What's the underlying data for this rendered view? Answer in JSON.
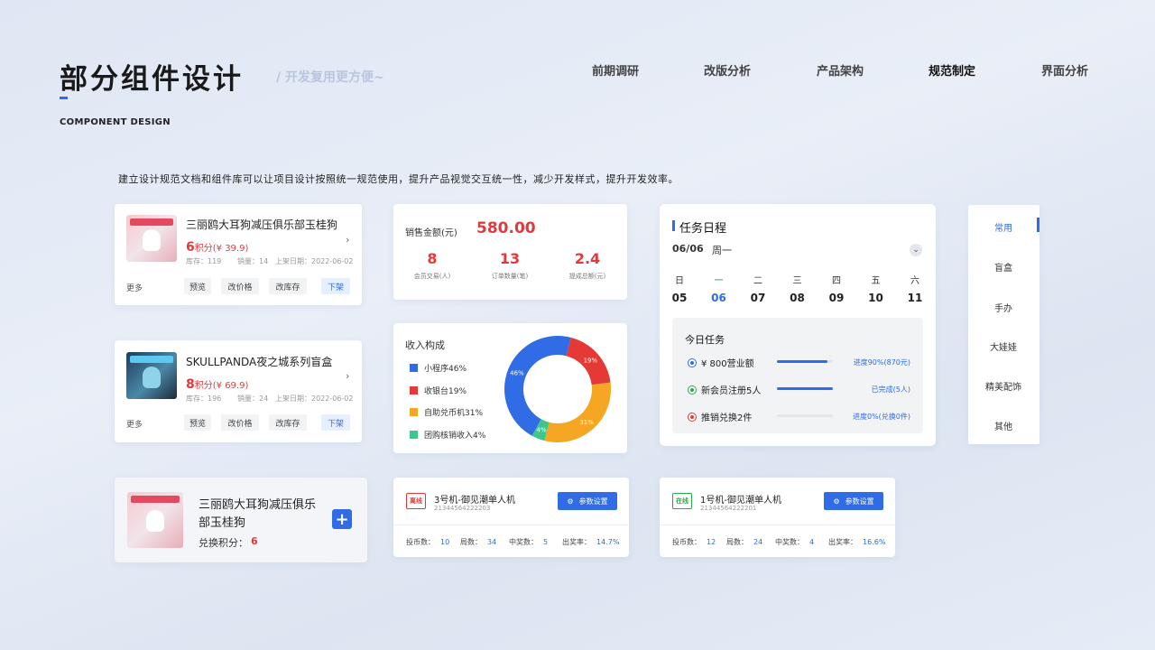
{
  "header": {
    "title": "部分组件设计",
    "subtitle": "/ 开发复用更方便~",
    "en_title": "COMPONENT DESIGN",
    "nav": [
      "前期调研",
      "改版分析",
      "产品架构",
      "规范制定",
      "界面分析"
    ],
    "active_nav": "规范制定"
  },
  "intro": "建立设计规范文档和组件库可以让项目设计按照统一规范使用，提升产品视觉交互统一性，减少开发样式，提升开发效率。",
  "products": [
    {
      "name": "三丽鸥大耳狗减压俱乐部玉桂狗",
      "points": "6",
      "price_text": "积分(¥ 39.9)",
      "stock": "库存：119",
      "sales": "销量：14",
      "date": "上架日期：2022-06-02",
      "more": "更多",
      "buttons": [
        "预览",
        "改价格",
        "改库存",
        "下架"
      ]
    },
    {
      "name": "SKULLPANDA夜之城系列盲盒",
      "points": "8",
      "price_text": "积分(¥ 69.9)",
      "stock": "库存：196",
      "sales": "销量：24",
      "date": "上架日期：2022-06-02",
      "more": "更多",
      "buttons": [
        "预览",
        "改价格",
        "改库存",
        "下架"
      ]
    }
  ],
  "redeem": {
    "name_line1": "三丽鸥大耳狗减压俱乐",
    "name_line2": "部玉桂狗",
    "label": "兑换积分：",
    "points": "6",
    "add_icon": "plus-icon"
  },
  "sales": {
    "label": "销售金额(元)",
    "amount": "580.00",
    "kpis": [
      {
        "value": "8",
        "label": "会员交易(人)"
      },
      {
        "value": "13",
        "label": "订单数量(笔)"
      },
      {
        "value": "2.4",
        "label": "提成总额(元)"
      }
    ]
  },
  "income": {
    "title": "收入构成",
    "legend": [
      {
        "label": "小程序46%",
        "color": "#2f6ce5"
      },
      {
        "label": "收银台19%",
        "color": "#e53935"
      },
      {
        "label": "自助兑币机31%",
        "color": "#f5a623"
      },
      {
        "label": "团购核销收入4%",
        "color": "#3cc88a"
      }
    ],
    "chart_data": {
      "type": "pie",
      "categories": [
        "小程序",
        "收银台",
        "自助兑币机",
        "团购核销收入"
      ],
      "values": [
        46,
        19,
        31,
        4
      ],
      "data_labels": [
        "46%",
        "19%",
        "31%",
        "4%"
      ],
      "colors": [
        "#2f6ce5",
        "#e53935",
        "#f5a623",
        "#3cc88a"
      ]
    }
  },
  "schedule": {
    "title": "任务日程",
    "date": "06/06",
    "weekday": "周一",
    "week_heads": [
      "日",
      "一",
      "二",
      "三",
      "四",
      "五",
      "六"
    ],
    "days": [
      "05",
      "06",
      "07",
      "08",
      "09",
      "10",
      "11"
    ],
    "selected_index": 1,
    "today_title": "今日任务",
    "tasks": [
      {
        "label": "¥ 800营业额",
        "note": "进度90%(870元)",
        "progress": 0.9,
        "color": "#2f6ce5"
      },
      {
        "label": "新会员注册5人",
        "note": "已完成(5人)",
        "progress": 1.0,
        "color": "#2aa84a"
      },
      {
        "label": "推销兑换2件",
        "note": "进度0%(兑换0件)",
        "progress": 0.0,
        "color": "#e53935"
      }
    ]
  },
  "side_menu": {
    "items": [
      "常用",
      "盲盒",
      "手办",
      "大娃娃",
      "精美配饰",
      "其他"
    ],
    "active": "常用"
  },
  "machines": [
    {
      "status": "离线",
      "status_color": "#e53935",
      "name": "3号机-御见潮单人机",
      "id": "21344564222203",
      "button": "参数设置",
      "stats": [
        {
          "k": "投币数：",
          "v": "10"
        },
        {
          "k": "局数：",
          "v": "34"
        },
        {
          "k": "中奖数：",
          "v": "5"
        },
        {
          "k": "出奖率：",
          "v": "14.7%"
        }
      ]
    },
    {
      "status": "在线",
      "status_color": "#2aa84a",
      "name": "1号机-御见潮单人机",
      "id": "21344564222201",
      "button": "参数设置",
      "stats": [
        {
          "k": "投币数：",
          "v": "12"
        },
        {
          "k": "局数：",
          "v": "24"
        },
        {
          "k": "中奖数：",
          "v": "4"
        },
        {
          "k": "出奖率：",
          "v": "16.6%"
        }
      ]
    }
  ]
}
